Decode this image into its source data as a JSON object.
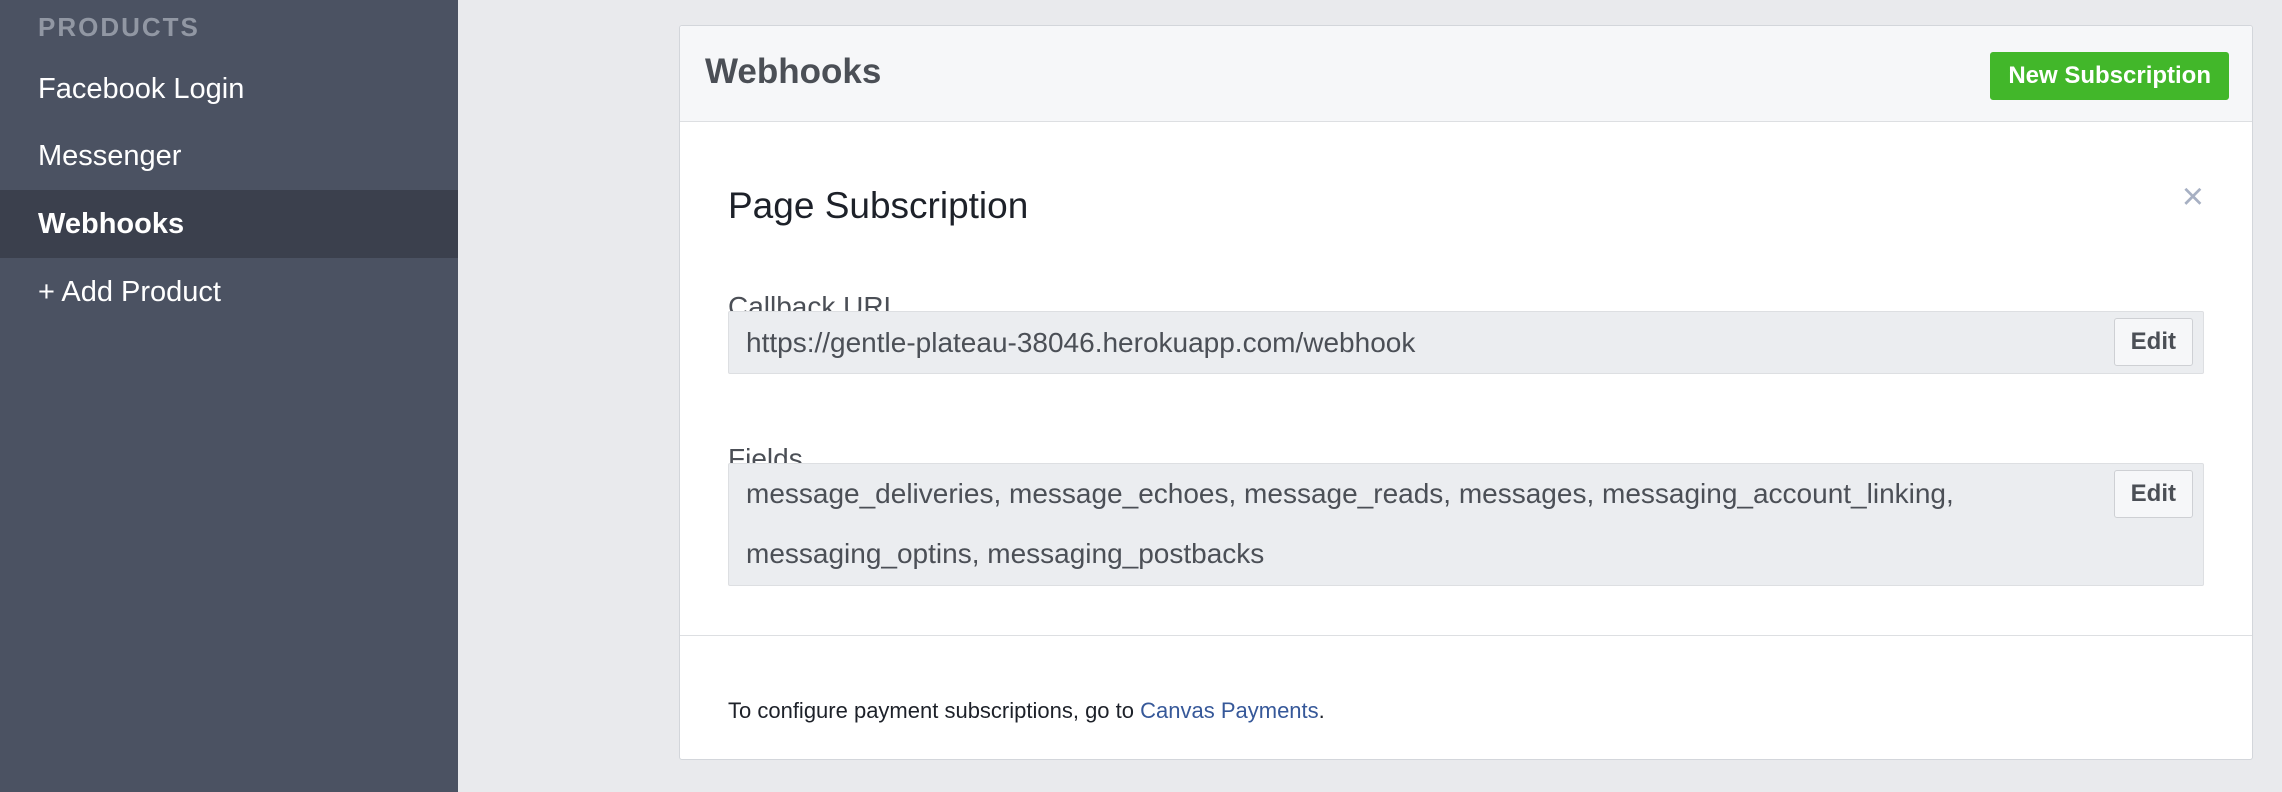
{
  "sidebar": {
    "heading": "PRODUCTS",
    "items": [
      {
        "label": "Facebook Login"
      },
      {
        "label": "Messenger"
      },
      {
        "label": "Webhooks"
      },
      {
        "label": "+ Add Product"
      }
    ]
  },
  "card": {
    "title": "Webhooks",
    "new_subscription_label": "New Subscription",
    "section_title": "Page Subscription",
    "close_glyph": "×",
    "callback_url": {
      "label": "Callback URL",
      "value": "https://gentle-plateau-38046.herokuapp.com/webhook",
      "edit_label": "Edit"
    },
    "fields": {
      "label": "Fields",
      "value": "message_deliveries, message_echoes, message_reads, messages, messaging_account_linking, messaging_optins, messaging_postbacks",
      "edit_label": "Edit"
    },
    "footer": {
      "prefix": "To configure payment subscriptions, go to ",
      "link_text": "Canvas Payments",
      "suffix": "."
    }
  },
  "colors": {
    "sidebar_bg": "#4b5262",
    "sidebar_active_bg": "#3b404d",
    "primary_button": "#42b72a",
    "link": "#365899"
  }
}
